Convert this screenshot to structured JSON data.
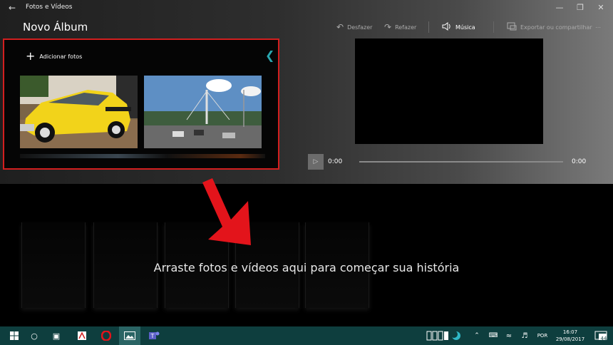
{
  "window": {
    "app_title": "Fotos e Vídeos",
    "page_title": "Novo Álbum"
  },
  "toolbar": {
    "undo_label": "Desfazer",
    "redo_label": "Refazer",
    "music_label": "Música",
    "export_label": "Exportar ou compartilhar",
    "more_label": "⋯"
  },
  "media": {
    "add_label": "Adicionar fotos"
  },
  "player": {
    "time_current": "0:00",
    "time_total": "0:00"
  },
  "storyboard": {
    "hint": "Arraste fotos e vídeos aqui para começar sua história"
  },
  "taskbar": {
    "language": "POR",
    "time": "16:07",
    "date": "29/08/2017",
    "notification_count": "44"
  },
  "colors": {
    "highlight_border": "#d21f1f",
    "arrow": "#e3141b",
    "accent": "#2aa7b0",
    "taskbar": "#0e3e3e"
  },
  "icons": [
    "back-arrow-icon",
    "undo-icon",
    "redo-icon",
    "speaker-icon",
    "export-icon",
    "more-icon",
    "plus-icon",
    "chevron-left-icon",
    "play-icon",
    "windows-icon",
    "cortana-icon",
    "task-view-icon",
    "acrobat-icon",
    "opera-icon",
    "photos-icon",
    "teams-icon",
    "battery-icon",
    "wifi-icon",
    "volume-icon",
    "notification-icon"
  ]
}
